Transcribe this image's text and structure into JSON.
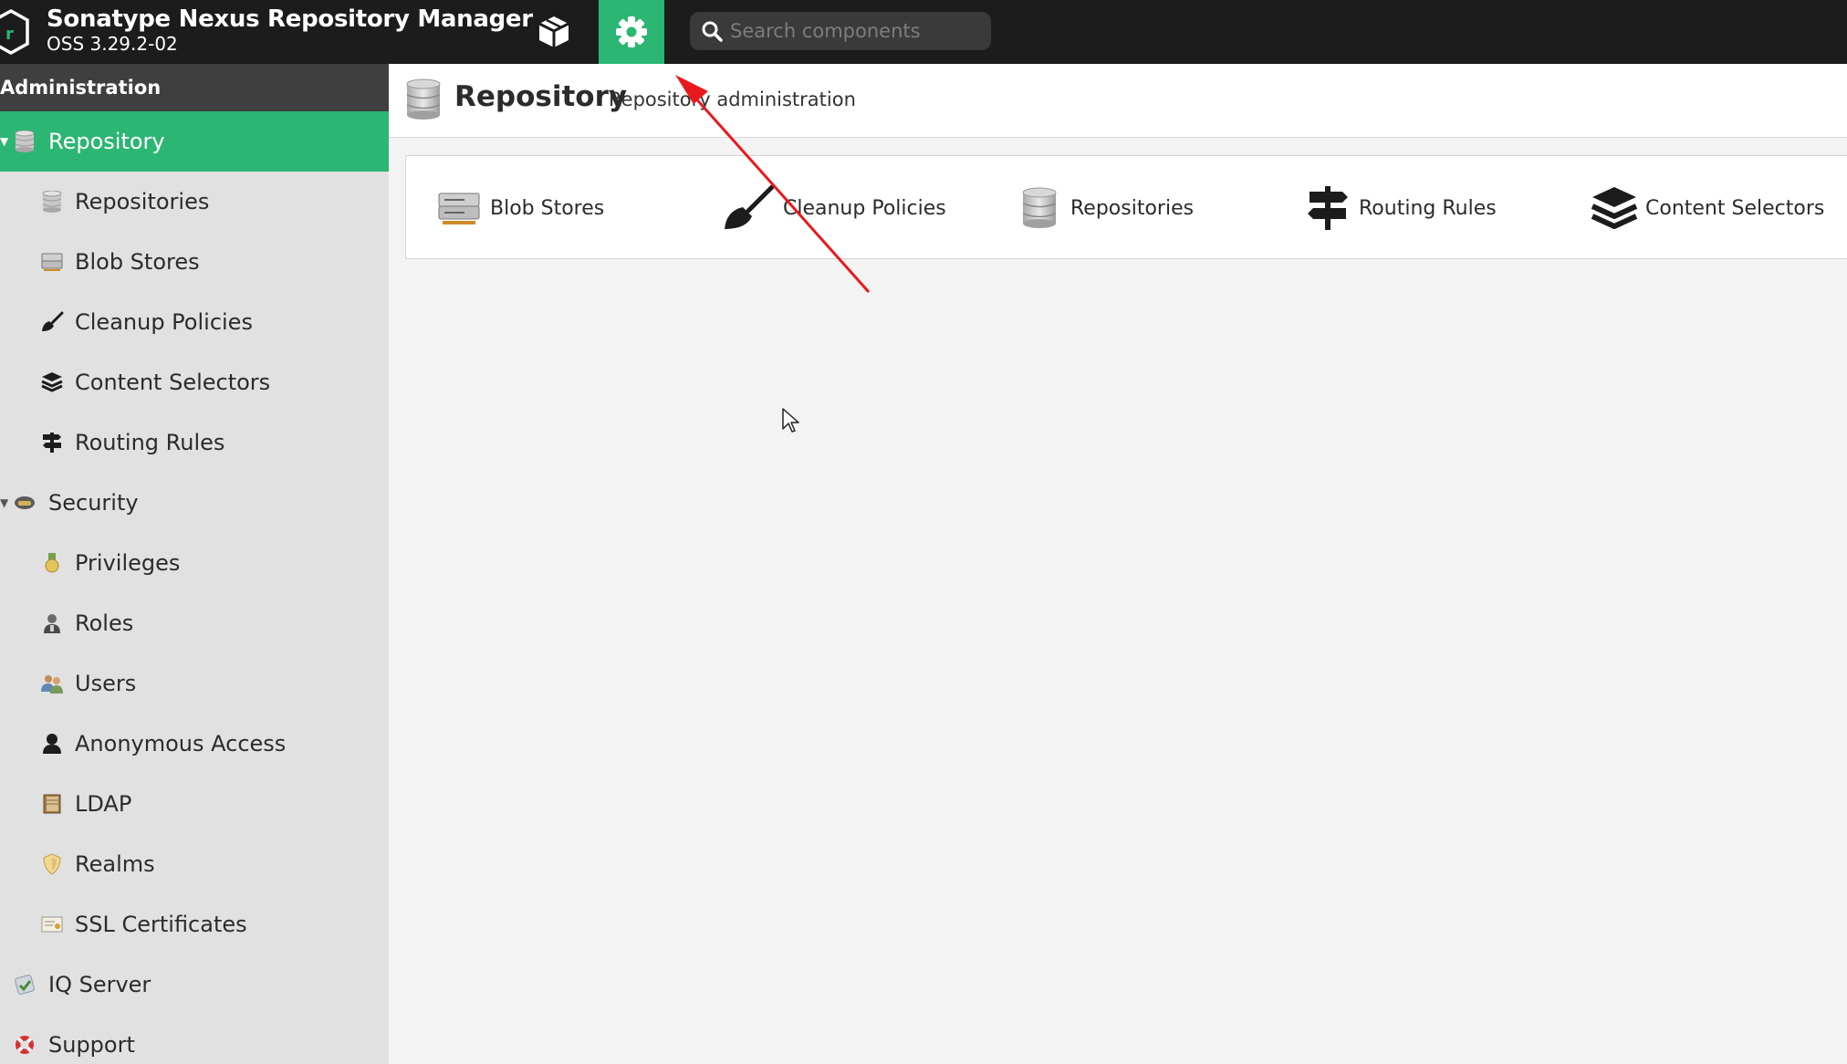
{
  "header": {
    "title": "Sonatype Nexus Repository Manager",
    "version": "OSS 3.29.2-02",
    "browse_icon": "cube-icon",
    "admin_icon": "gear-icon",
    "search": {
      "placeholder": "Search components",
      "value": ""
    }
  },
  "sidebar": {
    "heading": "Administration",
    "items": [
      {
        "label": "Repository",
        "icon": "database-icon",
        "level": 0,
        "expanded": true,
        "active": true
      },
      {
        "label": "Repositories",
        "icon": "database-icon",
        "level": 1
      },
      {
        "label": "Blob Stores",
        "icon": "server-icon",
        "level": 1
      },
      {
        "label": "Cleanup Policies",
        "icon": "broom-icon",
        "level": 1
      },
      {
        "label": "Content Selectors",
        "icon": "layers-icon",
        "level": 1
      },
      {
        "label": "Routing Rules",
        "icon": "signpost-icon",
        "level": 1
      },
      {
        "label": "Security",
        "icon": "helmet-icon",
        "level": 0,
        "expanded": true
      },
      {
        "label": "Privileges",
        "icon": "medal-icon",
        "level": 1
      },
      {
        "label": "Roles",
        "icon": "role-icon",
        "level": 1
      },
      {
        "label": "Users",
        "icon": "users-icon",
        "level": 1
      },
      {
        "label": "Anonymous Access",
        "icon": "user-icon",
        "level": 1
      },
      {
        "label": "LDAP",
        "icon": "book-icon",
        "level": 1
      },
      {
        "label": "Realms",
        "icon": "shield-icon",
        "level": 1
      },
      {
        "label": "SSL Certificates",
        "icon": "certificate-icon",
        "level": 1
      },
      {
        "label": "IQ Server",
        "icon": "iq-server-icon",
        "level": 0
      },
      {
        "label": "Support",
        "icon": "lifebuoy-icon",
        "level": 0
      }
    ]
  },
  "main": {
    "title": "Repository",
    "subtitle": "Repository administration",
    "features": [
      {
        "label": "Blob Stores",
        "icon": "server-icon"
      },
      {
        "label": "Cleanup Policies",
        "icon": "broom-icon"
      },
      {
        "label": "Repositories",
        "icon": "database-icon"
      },
      {
        "label": "Routing Rules",
        "icon": "signpost-icon"
      },
      {
        "label": "Content Selectors",
        "icon": "layers-icon"
      }
    ]
  },
  "colors": {
    "header_bg": "#1c1c1c",
    "accent": "#2bb673",
    "sidebar_bg": "#e1e1e1",
    "sidebar_heading_bg": "#3f3f3f",
    "annotation_arrow": "#e8191d"
  }
}
